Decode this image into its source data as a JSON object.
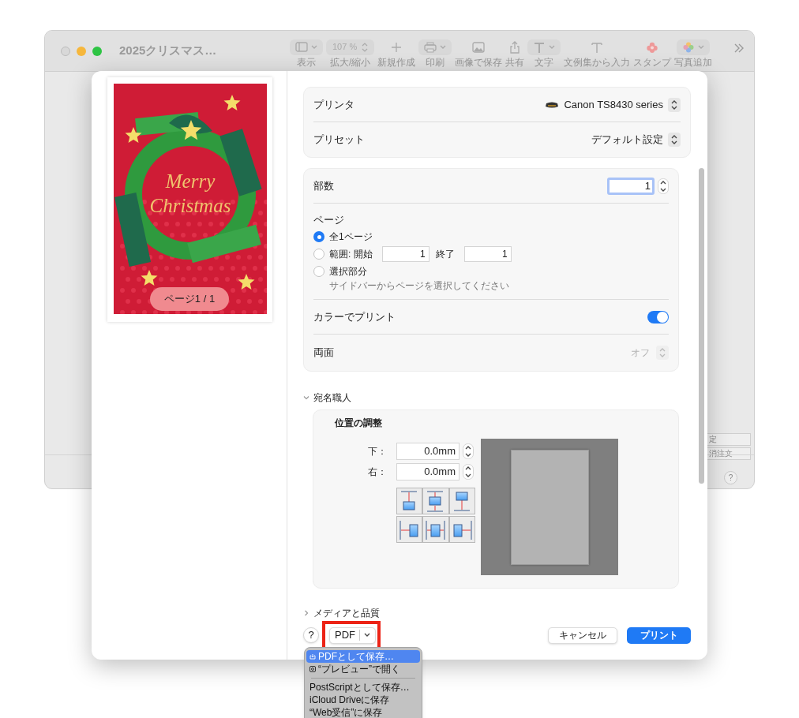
{
  "background_window": {
    "title": "2025クリスマス…",
    "zoom_value": "107 %",
    "toolbar": [
      {
        "label": "表示",
        "kind": "menu"
      },
      {
        "label": "拡大/縮小",
        "kind": "zoom"
      },
      {
        "label": "新規作成",
        "kind": "button"
      },
      {
        "label": "印刷",
        "kind": "menu"
      },
      {
        "label": "画像で保存",
        "kind": "button"
      },
      {
        "label": "共有",
        "kind": "button"
      },
      {
        "label": "文字",
        "kind": "menu"
      },
      {
        "label": "文例集から入力",
        "kind": "button"
      },
      {
        "label": "スタンプ",
        "kind": "button"
      },
      {
        "label": "写真追加",
        "kind": "menu"
      }
    ],
    "side_fields": [
      "定",
      "消注文"
    ],
    "help_button": "?"
  },
  "preview": {
    "card_text": "Merry Christmas",
    "page_badge": "ページ1 / 1"
  },
  "printer": {
    "label": "プリンタ",
    "value": "Canon TS8430 series"
  },
  "preset": {
    "label": "プリセット",
    "value": "デフォルト設定"
  },
  "copies": {
    "label": "部数",
    "value": "1"
  },
  "pages": {
    "label": "ページ",
    "options": [
      {
        "label": "全1ページ",
        "selected": true
      },
      {
        "label": "範囲: 開始",
        "selected": false
      },
      {
        "label": "選択部分",
        "selected": false
      }
    ],
    "from": "1",
    "to_label": "終了",
    "to": "1",
    "hint": "サイドバーからページを選択してください"
  },
  "color": {
    "label": "カラーでプリント",
    "on": true
  },
  "duplex": {
    "label": "両面",
    "value": "オフ",
    "disabled": true
  },
  "sections": [
    {
      "title": "宛名職人",
      "expanded": true
    },
    {
      "title": "メディアと品質",
      "expanded": false
    }
  ],
  "position": {
    "title": "位置の調整",
    "fields": [
      {
        "label": "下：",
        "value": "0.0mm"
      },
      {
        "label": "右：",
        "value": "0.0mm"
      }
    ]
  },
  "footer": {
    "help": "?",
    "pdf": "PDF",
    "cancel": "キャンセル",
    "print": "プリント"
  },
  "pdf_menu": {
    "groups": [
      [
        {
          "label": "PDFとして保存…",
          "kind": "save",
          "selected": true
        },
        {
          "label": "“プレビュー”で開く",
          "kind": "open",
          "selected": false
        }
      ],
      [
        {
          "label": "PostScriptとして保存…",
          "kind": "plain",
          "selected": false
        },
        {
          "label": "iCloud Driveに保存",
          "kind": "plain",
          "selected": false
        },
        {
          "label": "“Web受信”に保存",
          "kind": "plain",
          "selected": false
        }
      ]
    ]
  }
}
